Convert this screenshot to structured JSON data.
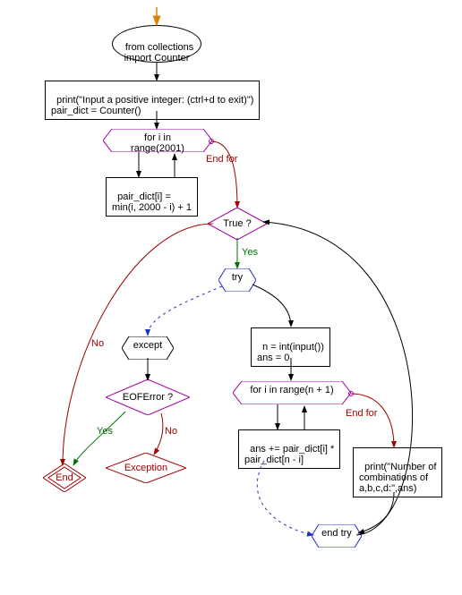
{
  "nodes": {
    "import": "from collections\nimport Counter",
    "print_init": "print(\"Input a positive integer: (ctrl+d to exit)\")\npair_dict = Counter()",
    "for1": "for i in range(2001)",
    "pair_calc": "pair_dict[i] =\nmin(i, 2000 - i) + 1",
    "while": "True ?",
    "try": "try",
    "except": "except",
    "eof": "EOFError ?",
    "end": "End",
    "exception": "Exception",
    "read_n": "n = int(input())\nans = 0",
    "for2": "for i in range(n + 1)",
    "ans_plus": "ans += pair_dict[i] *\npair_dict[n - i]",
    "print_ans": "print(\"Number of\ncombinations of\na,b,c,d:\",ans)",
    "endtry": "end try"
  },
  "edges": {
    "end_for": "End for",
    "yes": "Yes",
    "no": "No"
  },
  "colors": {
    "magenta": "#a000a0",
    "blue": "#2030c0",
    "red": "#a00000",
    "green": "#007000",
    "orange": "#e08000"
  }
}
